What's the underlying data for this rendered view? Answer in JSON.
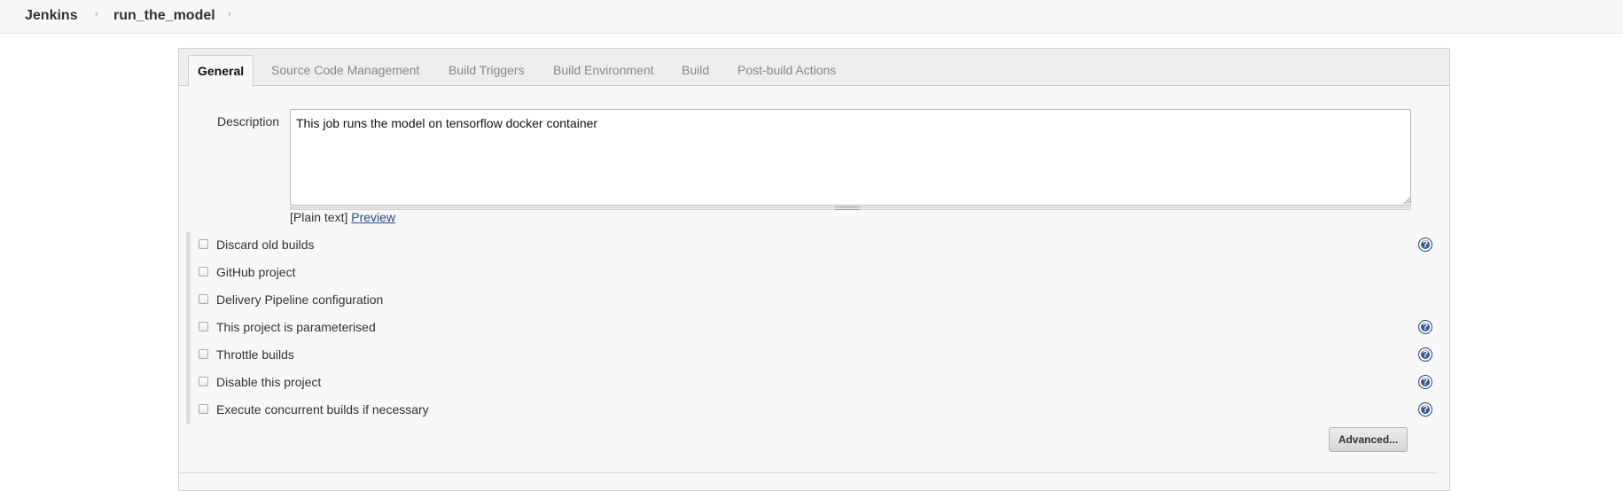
{
  "breadcrumb": {
    "items": [
      "Jenkins",
      "run_the_model"
    ],
    "separator": "›"
  },
  "tabs": [
    {
      "label": "General",
      "active": true
    },
    {
      "label": "Source Code Management",
      "active": false
    },
    {
      "label": "Build Triggers",
      "active": false
    },
    {
      "label": "Build Environment",
      "active": false
    },
    {
      "label": "Build",
      "active": false
    },
    {
      "label": "Post-build Actions",
      "active": false
    }
  ],
  "description": {
    "label": "Description",
    "value": "This job runs the model on tensorflow docker container",
    "format_prefix": "[Plain text]",
    "preview_link": "Preview"
  },
  "options": [
    {
      "label": "Discard old builds",
      "checked": false,
      "help": true
    },
    {
      "label": "GitHub project",
      "checked": false,
      "help": false
    },
    {
      "label": "Delivery Pipeline configuration",
      "checked": false,
      "help": false
    },
    {
      "label": "This project is parameterised",
      "checked": false,
      "help": true
    },
    {
      "label": "Throttle builds",
      "checked": false,
      "help": true
    },
    {
      "label": "Disable this project",
      "checked": false,
      "help": true
    },
    {
      "label": "Execute concurrent builds if necessary",
      "checked": false,
      "help": true
    }
  ],
  "help_glyph": "?",
  "advanced_button": {
    "label": "Advanced..."
  },
  "colors": {
    "help_icon": "#3a5a9a",
    "link": "#204a87",
    "panel_background": "#f8f8f8"
  },
  "icons": {
    "help": "question-circle-icon",
    "checkbox": "checkbox-unchecked"
  }
}
